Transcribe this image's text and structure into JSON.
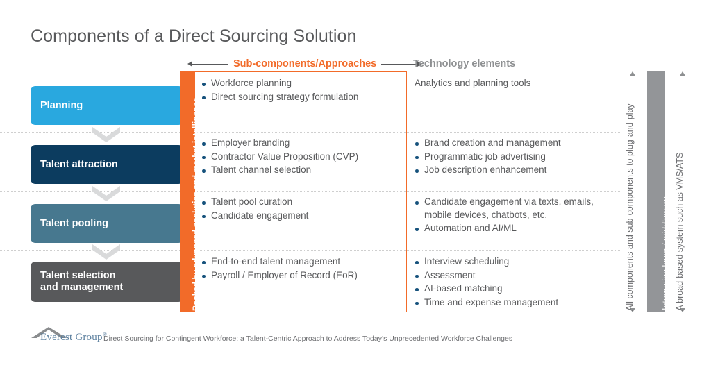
{
  "title": "Components of a Direct Sourcing Solution",
  "headers": {
    "sub_components": "Sub-components/Approaches",
    "technology": "Technology elements"
  },
  "bands": {
    "left_band": "Backed by advanced analytics and market intelligence",
    "left_band_color": "#F26B29",
    "integration_band": "Integration layer / middleware",
    "integration_band_color": "#939598",
    "annotation_left": "All components and sub-components to plug-and-play",
    "annotation_right": "A broad-based system such as VMS/ATS"
  },
  "rows": [
    {
      "stage": "Planning",
      "stage_color": "#29A8DF",
      "sub_components": [
        "Workforce planning",
        "Direct sourcing strategy formulation"
      ],
      "technology_plain": "Analytics and planning tools",
      "technology": []
    },
    {
      "stage": "Talent attraction",
      "stage_color": "#0C3C5F",
      "sub_components": [
        "Employer branding",
        "Contractor Value Proposition (CVP)",
        "Talent channel selection"
      ],
      "technology": [
        "Brand creation and management",
        "Programmatic job advertising",
        "Job description enhancement"
      ]
    },
    {
      "stage": "Talent pooling",
      "stage_color": "#47788F",
      "sub_components": [
        "Talent pool curation",
        "Candidate engagement"
      ],
      "technology": [
        "Candidate engagement via texts, emails, mobile devices, chatbots, etc.",
        "Automation and AI/ML"
      ]
    },
    {
      "stage": "Talent selection and management",
      "stage_color": "#58595B",
      "sub_components": [
        "End-to-end talent management",
        "Payroll / Employer of Record (EoR)"
      ],
      "technology": [
        "Interview scheduling",
        "Assessment",
        "AI-based matching",
        "Time and expense management"
      ]
    }
  ],
  "footer": {
    "logo_text": "Everest Group",
    "logo_mark": "®",
    "note": "Direct Sourcing for Contingent Workforce: a Talent-Centric Approach to Address Today’s Unprecedented Workforce Challenges"
  }
}
